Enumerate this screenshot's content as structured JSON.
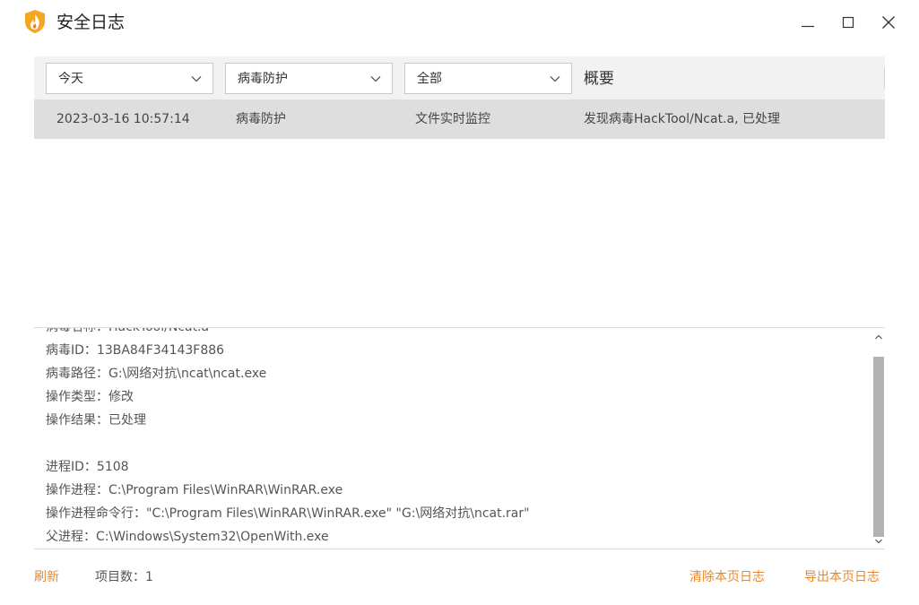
{
  "window": {
    "title": "安全日志",
    "brand_color": "#f08a24"
  },
  "filters": {
    "date": "今天",
    "category": "病毒防护",
    "type": "全部",
    "summary_header": "概要"
  },
  "log_rows": [
    {
      "time": "2023-03-16 10:57:14",
      "category": "病毒防护",
      "source": "文件实时监控",
      "summary": "发现病毒HackTool/Ncat.a, 已处理"
    }
  ],
  "details": {
    "lines": [
      "病毒名称：HackTool/Ncat.a",
      "病毒ID：13BA84F34143F886",
      "病毒路径：G:\\网络对抗\\ncat\\ncat.exe",
      "操作类型：修改",
      "操作结果：已处理",
      "",
      "进程ID：5108",
      "操作进程：C:\\Program Files\\WinRAR\\WinRAR.exe",
      "操作进程命令行：\"C:\\Program Files\\WinRAR\\WinRAR.exe\" \"G:\\网络对抗\\ncat.rar\"",
      "父进程：C:\\Windows\\System32\\OpenWith.exe"
    ]
  },
  "footer": {
    "refresh": "刷新",
    "item_count": "项目数：1",
    "clear_page_log": "清除本页日志",
    "export_page_log": "导出本页日志",
    "link_color": "#e8882e"
  },
  "icons": {
    "app": "flame-shield-icon",
    "minimize": "minimize-icon",
    "maximize": "maximize-icon",
    "close": "close-icon",
    "dropdown": "chevron-down-icon",
    "scroll_up": "chevron-up-icon",
    "scroll_down": "chevron-down-icon"
  }
}
